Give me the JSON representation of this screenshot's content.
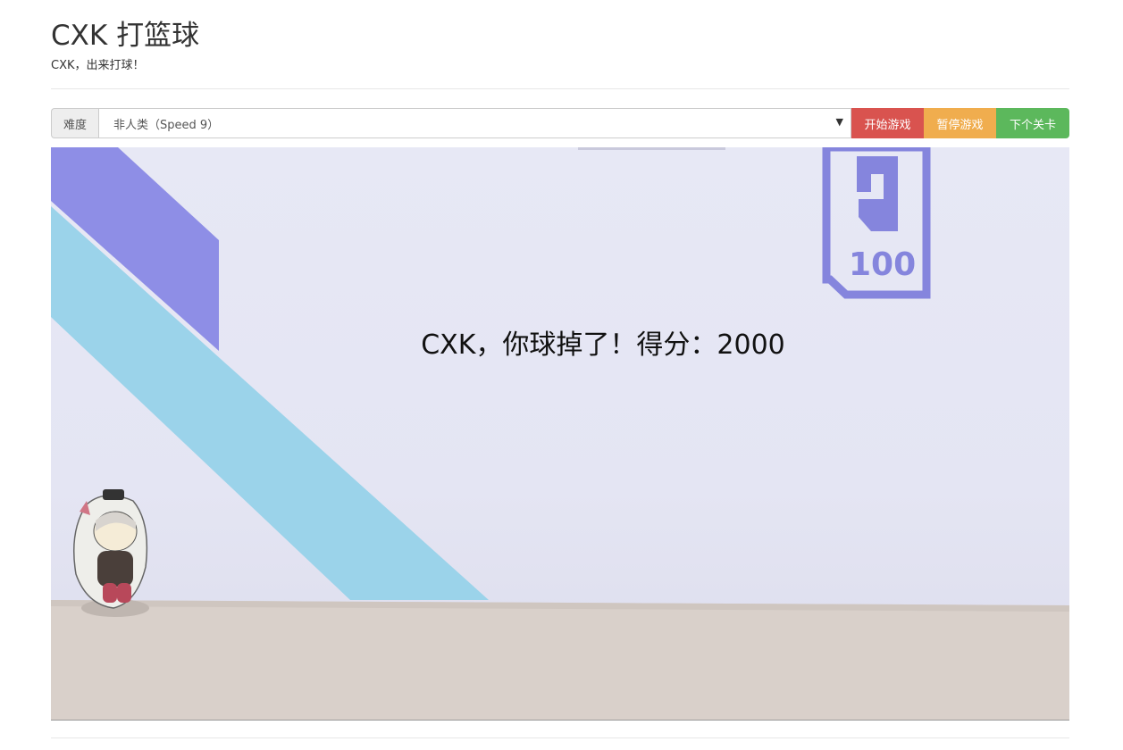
{
  "header": {
    "title": "CXK 打篮球",
    "subtitle": "CXK，出来打球！"
  },
  "controls": {
    "difficulty_label": "难度",
    "difficulty_selected": "非人类（Speed 9）",
    "start_label": "开始游戏",
    "pause_label": "暂停游戏",
    "next_label": "下个关卡"
  },
  "game": {
    "message": "CXK，你球掉了！得分：2000",
    "logo_text": "100"
  },
  "colors": {
    "start": "#d9534f",
    "pause": "#f0ad4e",
    "next": "#5cb85c",
    "stripe_purple": "#8e8ee6",
    "stripe_blue": "#9bd3ea",
    "floor": "#d9d0ca"
  }
}
